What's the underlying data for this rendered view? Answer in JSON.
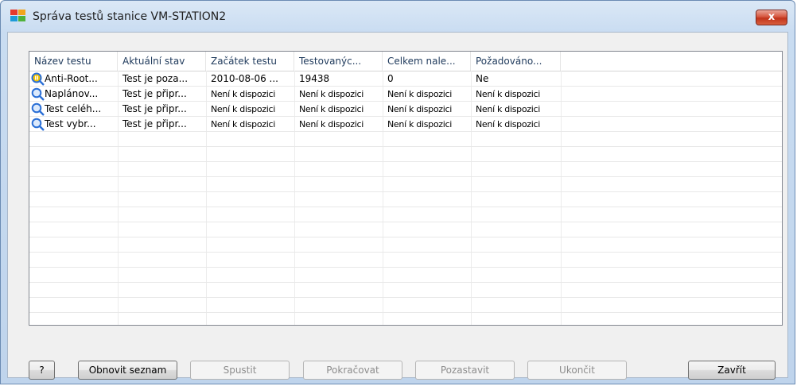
{
  "window": {
    "title": "Správa testů stanice VM-STATION2",
    "close_label": "x"
  },
  "table": {
    "columns": [
      "Název testu",
      "Aktuální stav",
      "Začátek testu",
      "Testovanýc...",
      "Celkem nale...",
      "Požadováno..."
    ],
    "rows": [
      {
        "icon": "paused-search-icon",
        "cells": [
          "Anti-Root...",
          "Test je poza...",
          "2010-08-06 ...",
          "19438",
          "0",
          "Ne"
        ]
      },
      {
        "icon": "search-icon",
        "cells": [
          "Naplánov...",
          "Test je připr...",
          "Není k dispozici",
          "Není k dispozici",
          "Není k dispozici",
          "Není k dispozici"
        ]
      },
      {
        "icon": "search-icon",
        "cells": [
          "Test celéh...",
          "Test je připr...",
          "Není k dispozici",
          "Není k dispozici",
          "Není k dispozici",
          "Není k dispozici"
        ]
      },
      {
        "icon": "search-icon",
        "cells": [
          "Test vybr...",
          "Test je připr...",
          "Není k dispozici",
          "Není k dispozici",
          "Není k dispozici",
          "Není k dispozici"
        ]
      }
    ]
  },
  "buttons": {
    "help": "?",
    "refresh": "Obnovit seznam",
    "start": "Spustit",
    "resume": "Pokračovat",
    "pause": "Pozastavit",
    "stop": "Ukončit",
    "close": "Zavřít"
  },
  "colors": {
    "titlebar": "#c9dcf1",
    "close_button": "#c0341c",
    "header_text": "#1e395b",
    "icon_blue": "#2a6fd6",
    "icon_yellow": "#f2c200"
  }
}
